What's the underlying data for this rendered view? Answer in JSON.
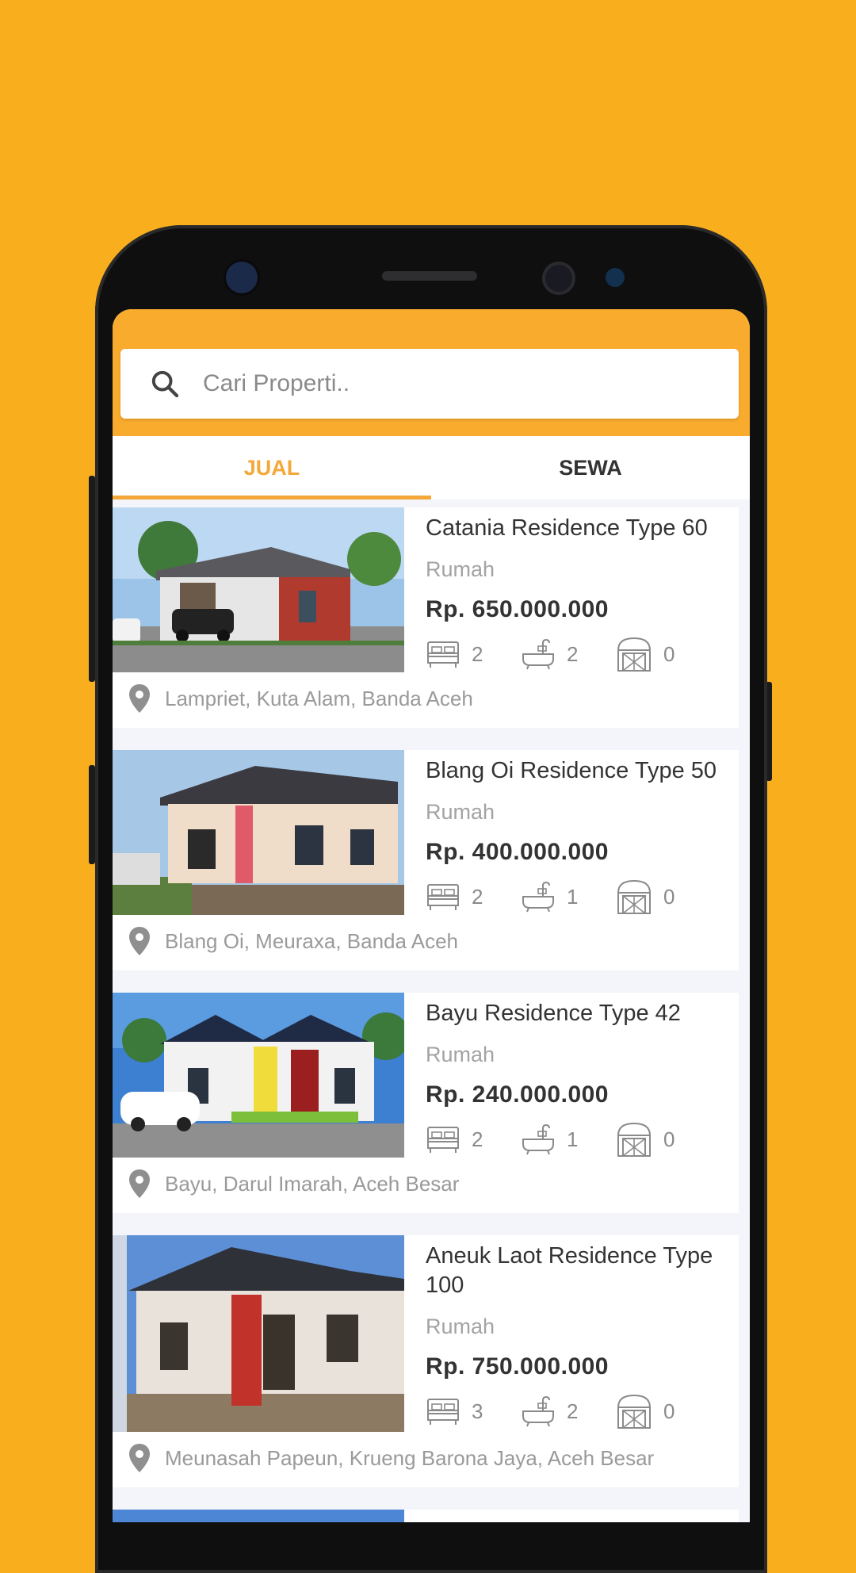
{
  "colors": {
    "background": "#F9AE1E",
    "accent": "#F5A83A",
    "header": "#F9AB2E"
  },
  "search": {
    "placeholder": "Cari Properti.."
  },
  "tabs": [
    {
      "label": "JUAL",
      "active": true
    },
    {
      "label": "SEWA",
      "active": false
    }
  ],
  "listings": [
    {
      "title": "Catania Residence Type 60",
      "type": "Rumah",
      "price": "Rp. 650.000.000",
      "bedrooms": "2",
      "bathrooms": "2",
      "garage": "0",
      "location": "Lampriet, Kuta Alam, Banda Aceh"
    },
    {
      "title": "Blang Oi Residence Type 50",
      "type": "Rumah",
      "price": "Rp. 400.000.000",
      "bedrooms": "2",
      "bathrooms": "1",
      "garage": "0",
      "location": "Blang Oi, Meuraxa, Banda Aceh"
    },
    {
      "title": "Bayu Residence Type 42",
      "type": "Rumah",
      "price": "Rp. 240.000.000",
      "bedrooms": "2",
      "bathrooms": "1",
      "garage": "0",
      "location": "Bayu, Darul Imarah, Aceh Besar"
    },
    {
      "title": "Aneuk Laot Residence Type 100",
      "type": "Rumah",
      "price": "Rp. 750.000.000",
      "bedrooms": "3",
      "bathrooms": "2",
      "garage": "0",
      "location": "Meunasah Papeun,  Krueng Barona Jaya, Aceh Besar"
    }
  ],
  "icons": {
    "search": "search-icon",
    "bed": "bed-icon",
    "bath": "bathtub-icon",
    "garage": "garage-icon",
    "location": "location-pin-icon"
  }
}
